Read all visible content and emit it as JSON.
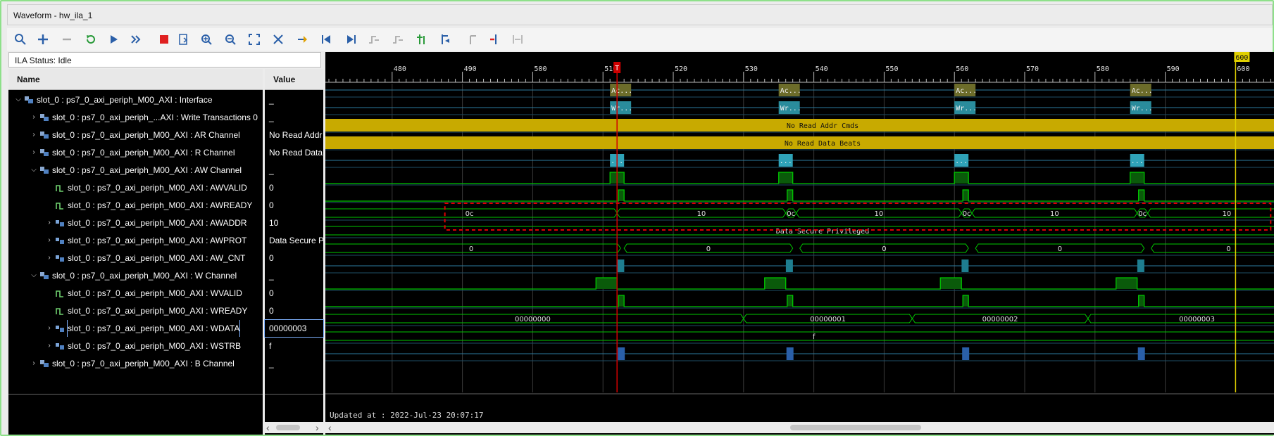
{
  "window": {
    "title": "Waveform - hw_ila_1"
  },
  "toolbar": {
    "icons": [
      "search-icon",
      "plus-icon",
      "minus-icon",
      "refresh-icon",
      "run-icon",
      "fast-forward-icon",
      "stop-icon",
      "export-icon",
      "zoom-in-icon",
      "zoom-out-icon",
      "zoom-fit-icon",
      "cursor-cut-icon",
      "marker-icon",
      "go-first-icon",
      "go-last-icon",
      "prev-transition-icon",
      "next-transition-icon",
      "add-marker-icon",
      "prev-marker-icon",
      "next-marker-icon",
      "remove-marker-icon",
      "swap-icon"
    ]
  },
  "ila_status": "ILA Status: Idle",
  "headers": {
    "name": "Name",
    "value": "Value"
  },
  "signals": [
    {
      "name": "slot_0 : ps7_0_axi_periph_M00_AXI : Interface",
      "value": "_",
      "indent": 0,
      "expand": "down",
      "icon": "interface"
    },
    {
      "name": "slot_0 : ps7_0_axi_periph_...AXI : Write Transactions 0",
      "value": "_",
      "indent": 1,
      "expand": "right",
      "icon": "interface"
    },
    {
      "name": "slot_0 : ps7_0_axi_periph_M00_AXI : AR Channel",
      "value": "No Read Addr",
      "indent": 1,
      "expand": "right",
      "icon": "interface"
    },
    {
      "name": "slot_0 : ps7_0_axi_periph_M00_AXI : R Channel",
      "value": "No Read Data",
      "indent": 1,
      "expand": "right",
      "icon": "interface"
    },
    {
      "name": "slot_0 : ps7_0_axi_periph_M00_AXI : AW Channel",
      "value": "_",
      "indent": 1,
      "expand": "down",
      "icon": "interface"
    },
    {
      "name": "slot_0 : ps7_0_axi_periph_M00_AXI : AWVALID",
      "value": "0",
      "indent": 2,
      "expand": "",
      "icon": "bit"
    },
    {
      "name": "slot_0 : ps7_0_axi_periph_M00_AXI : AWREADY",
      "value": "0",
      "indent": 2,
      "expand": "",
      "icon": "bit"
    },
    {
      "name": "slot_0 : ps7_0_axi_periph_M00_AXI : AWADDR",
      "value": "10",
      "indent": 2,
      "expand": "right",
      "icon": "bus"
    },
    {
      "name": "slot_0 : ps7_0_axi_periph_M00_AXI : AWPROT",
      "value": "Data Secure P",
      "indent": 2,
      "expand": "right",
      "icon": "bus"
    },
    {
      "name": "slot_0 : ps7_0_axi_periph_M00_AXI : AW_CNT",
      "value": "0",
      "indent": 2,
      "expand": "right",
      "icon": "bus"
    },
    {
      "name": "slot_0 : ps7_0_axi_periph_M00_AXI : W Channel",
      "value": "_",
      "indent": 1,
      "expand": "down",
      "icon": "interface"
    },
    {
      "name": "slot_0 : ps7_0_axi_periph_M00_AXI : WVALID",
      "value": "0",
      "indent": 2,
      "expand": "",
      "icon": "bit"
    },
    {
      "name": "slot_0 : ps7_0_axi_periph_M00_AXI : WREADY",
      "value": "0",
      "indent": 2,
      "expand": "",
      "icon": "bit"
    },
    {
      "name": "slot_0 : ps7_0_axi_periph_M00_AXI : WDATA",
      "value": "00000003",
      "indent": 2,
      "expand": "right",
      "icon": "bus",
      "selected": true
    },
    {
      "name": "slot_0 : ps7_0_axi_periph_M00_AXI : WSTRB",
      "value": "f",
      "indent": 2,
      "expand": "right",
      "icon": "bus"
    },
    {
      "name": "slot_0 : ps7_0_axi_periph_M00_AXI : B Channel",
      "value": "_",
      "indent": 1,
      "expand": "right",
      "icon": "interface"
    }
  ],
  "timeline": {
    "ticks": [
      "480",
      "490",
      "500",
      "510",
      "520",
      "530",
      "540",
      "550",
      "560",
      "570",
      "580",
      "590",
      "600"
    ],
    "cursor_label": "T",
    "marker_label": "600",
    "cursor_time": 512,
    "marker_time": 600
  },
  "bursts": [
    512,
    536,
    561,
    586
  ],
  "wave_text": {
    "write_tx_a": "Ac...",
    "write_tx_b": "Wr...",
    "ar": "No Read Addr Cmds",
    "r": "No Read Data Beats",
    "aw": "...",
    "awaddr": [
      "0c",
      "10",
      "0c",
      "10",
      "0c",
      "10",
      "0c",
      "10"
    ],
    "awprot": "Data Secure Privileged",
    "aw_cnt": [
      "0",
      "0",
      "0",
      "0",
      "0"
    ],
    "wdata": [
      "00000000",
      "00000001",
      "00000002",
      "00000003"
    ],
    "wstrb": "f"
  },
  "colors": {
    "bus": "#00c800",
    "green_fill": "#0a5a0a",
    "cyan": "#2fa3b8",
    "olive": "#6c6c2a",
    "yellow_bar": "#c8aa00",
    "cursor": "#d00000",
    "marker": "#e0d000",
    "highlight": "#e00000"
  },
  "footer": {
    "updated": "Updated at : 2022-Jul-23 20:07:17"
  }
}
